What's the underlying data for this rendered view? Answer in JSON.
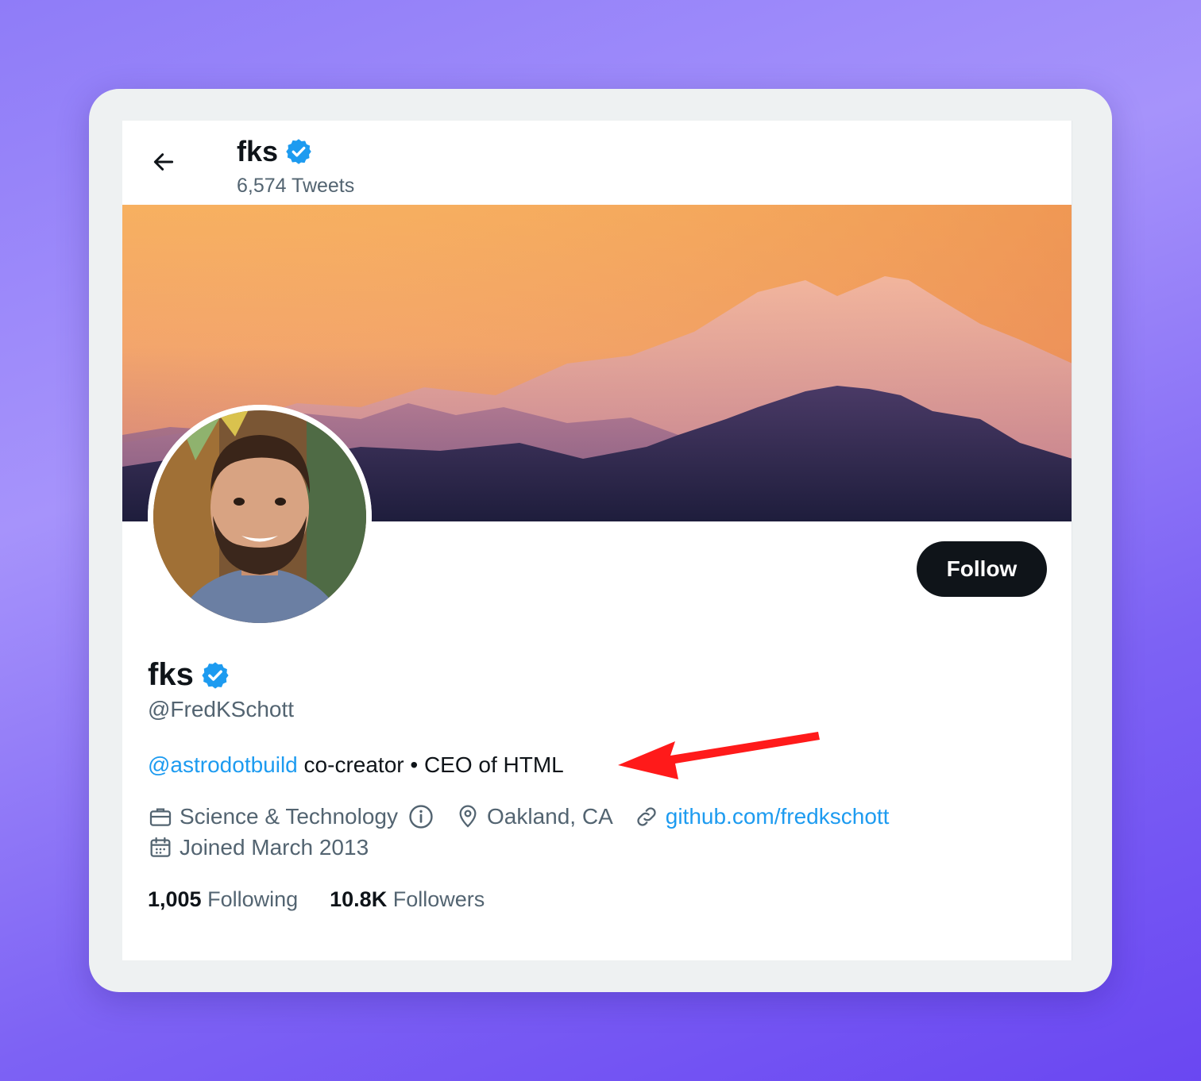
{
  "header": {
    "name": "fks",
    "tweets_count": "6,574 Tweets"
  },
  "profile": {
    "display_name": "fks",
    "handle": "@FredKSchott",
    "bio_mention": "@astrodotbuild",
    "bio_text": " co-creator • CEO of HTML",
    "follow_label": "Follow"
  },
  "meta": {
    "category": "Science & Technology",
    "location": "Oakland, CA",
    "website": "github.com/fredkschott",
    "joined": "Joined March 2013"
  },
  "stats": {
    "following_count": "1,005",
    "following_label": " Following",
    "followers_count": "10.8K",
    "followers_label": " Followers"
  },
  "icons": {
    "back": "arrow-left-icon",
    "verified": "verified-badge-icon",
    "category": "briefcase-icon",
    "info": "info-icon",
    "location": "location-pin-icon",
    "website": "link-icon",
    "joined": "calendar-icon"
  },
  "colors": {
    "accent": "#1d9bf0",
    "text": "#0f1419",
    "secondary": "#536471",
    "annotation_arrow": "#ff1a1a"
  }
}
